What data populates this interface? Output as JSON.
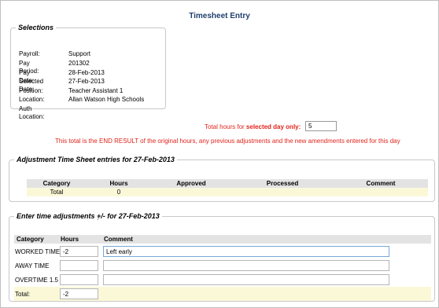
{
  "window": {
    "title": "Timesheet Entry"
  },
  "selections": {
    "legend": "Selections",
    "fields": [
      {
        "label": "Payroll:",
        "value": "Support"
      },
      {
        "label": "Pay Period:",
        "value": "201302"
      },
      {
        "label": "Pay Date:",
        "value": "28-Feb-2013"
      },
      {
        "label": "Selected Date:",
        "value": "27-Feb-2013"
      },
      {
        "label": "Position:",
        "value": "Teacher Assistant 1"
      },
      {
        "label": "Location:",
        "value": "Allan Watson High Schools"
      },
      {
        "label": "Auth Location:",
        "value": ""
      }
    ]
  },
  "total_hours": {
    "label_prefix": "Total hours for ",
    "label_bold": "selected day only:",
    "value": "5",
    "note": "This total is the END RESULT of the original hours, any previous adjustments and the new amendments entered for this day"
  },
  "adjustment": {
    "legend": "Adjustment Time Sheet entries for 27-Feb-2013",
    "headers": [
      "Category",
      "Hours",
      "Approved",
      "Processed",
      "Comment"
    ],
    "total_row": {
      "label": "Total",
      "hours": "0"
    }
  },
  "entry": {
    "legend": "Enter time adjustments +/- for 27-Feb-2013",
    "headers": {
      "category": "Category",
      "hours": "Hours",
      "comment": "Comment"
    },
    "rows": [
      {
        "category": "WORKED TIME",
        "hours": "-2",
        "comment": "Left early"
      },
      {
        "category": "AWAY TIME",
        "hours": "",
        "comment": ""
      },
      {
        "category": "OVERTIME 1.5",
        "hours": "",
        "comment": ""
      }
    ],
    "total": {
      "label": "Total:",
      "value": "-2"
    }
  }
}
